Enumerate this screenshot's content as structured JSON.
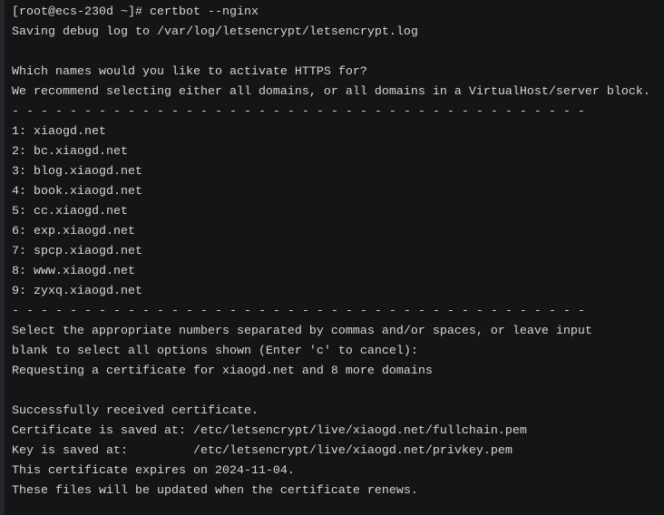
{
  "terminal": {
    "colors": {
      "background": "#141517",
      "text": "#d6d6d6"
    },
    "lines": [
      "[root@ecs-230d ~]# certbot --nginx",
      "Saving debug log to /var/log/letsencrypt/letsencrypt.log",
      "",
      "Which names would you like to activate HTTPS for?",
      "We recommend selecting either all domains, or all domains in a VirtualHost/server block.",
      "- - - - - - - - - - - - - - - - - - - - - - - - - - - - - - - - - - - - - - - -",
      "1: xiaogd.net",
      "2: bc.xiaogd.net",
      "3: blog.xiaogd.net",
      "4: book.xiaogd.net",
      "5: cc.xiaogd.net",
      "6: exp.xiaogd.net",
      "7: spcp.xiaogd.net",
      "8: www.xiaogd.net",
      "9: zyxq.xiaogd.net",
      "- - - - - - - - - - - - - - - - - - - - - - - - - - - - - - - - - - - - - - - -",
      "Select the appropriate numbers separated by commas and/or spaces, or leave input",
      "blank to select all options shown (Enter 'c' to cancel):",
      "Requesting a certificate for xiaogd.net and 8 more domains",
      "",
      "Successfully received certificate.",
      "Certificate is saved at: /etc/letsencrypt/live/xiaogd.net/fullchain.pem",
      "Key is saved at:         /etc/letsencrypt/live/xiaogd.net/privkey.pem",
      "This certificate expires on 2024-11-04.",
      "These files will be updated when the certificate renews."
    ]
  }
}
